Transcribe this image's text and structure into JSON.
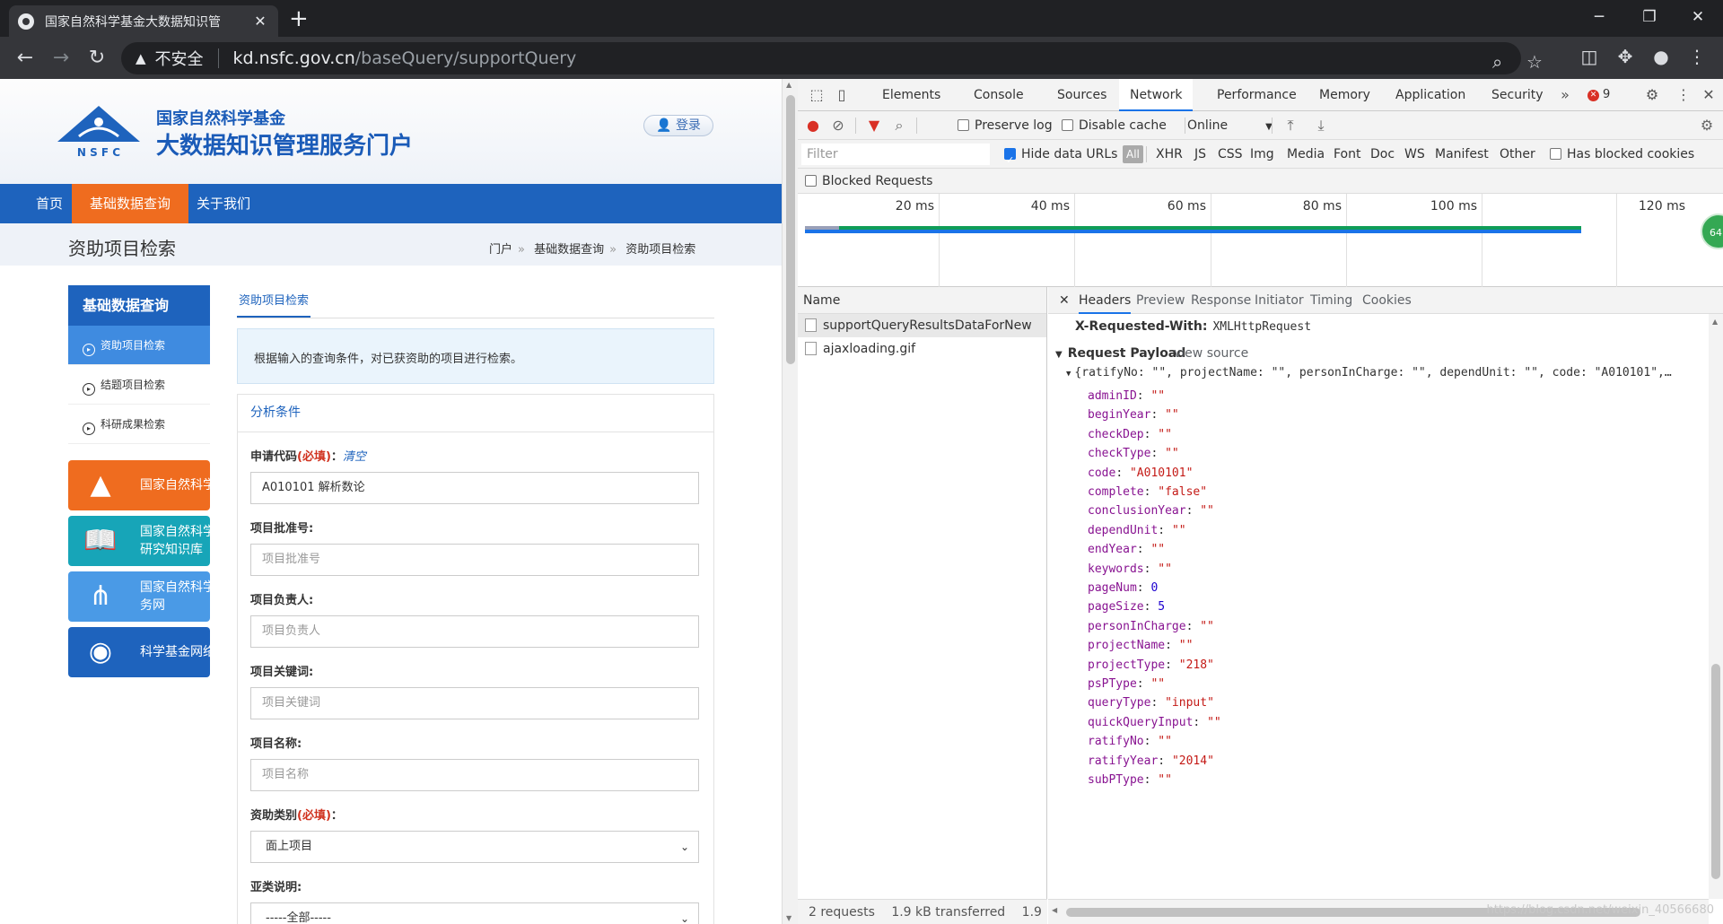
{
  "browser": {
    "tab_title": "国家自然科学基金大数据知识管",
    "url_insecure": "不安全",
    "url_host": "kd.nsfc.gov.cn",
    "url_path": "/baseQuery/supportQuery"
  },
  "site": {
    "logo_abbr": "N S F C",
    "logo_line1": "国家自然科学基金",
    "logo_line2": "大数据知识管理服务门户",
    "login": "登录",
    "nav": [
      "首页",
      "基础数据查询",
      "关于我们"
    ],
    "page_title": "资助项目检索",
    "breadcrumb": [
      "门户",
      "基础数据查询",
      "资助项目检索"
    ],
    "sidebar": {
      "head": "基础数据查询",
      "items": [
        "资助项目检索",
        "结题项目检索",
        "科研成果检索"
      ],
      "cards": [
        "国家自然科学",
        "国家自然科学",
        "研究知识库",
        "国家自然科学",
        "务网",
        "科学基金网络"
      ]
    },
    "content_tab": "资助项目检索",
    "info": "根据输入的查询条件，对已获资助的项目进行检索。",
    "form_head": "分析条件",
    "fields": {
      "code_label": "申请代码",
      "required": "(必填)",
      "colon": "：",
      "clear": "清空",
      "code_value": "A010101 解析数论",
      "ratify_label": "项目批准号:",
      "ratify_ph": "项目批准号",
      "person_label": "项目负责人:",
      "person_ph": "项目负责人",
      "keyword_label": "项目关键词:",
      "keyword_ph": "项目关键词",
      "name_label": "项目名称:",
      "name_ph": "项目名称",
      "type_label": "资助类别",
      "type_value": "面上项目",
      "subtype_label": "亚类说明:",
      "subtype_value": "-----全部-----"
    }
  },
  "devtools": {
    "tabs": [
      "Elements",
      "Console",
      "Sources",
      "Network",
      "Performance",
      "Memory",
      "Application",
      "Security"
    ],
    "error_count": "9",
    "toolbar": {
      "preserve_log": "Preserve log",
      "disable_cache": "Disable cache",
      "throttle": "Online"
    },
    "filter": {
      "placeholder": "Filter",
      "hide_data_urls": "Hide data URLs",
      "types": [
        "All",
        "XHR",
        "JS",
        "CSS",
        "Img",
        "Media",
        "Font",
        "Doc",
        "WS",
        "Manifest",
        "Other"
      ],
      "has_blocked": "Has blocked cookies",
      "blocked_requests": "Blocked Requests"
    },
    "overview_ticks": [
      "20 ms",
      "40 ms",
      "60 ms",
      "80 ms",
      "100 ms",
      "120 ms"
    ],
    "overview_badge": "64",
    "name_header": "Name",
    "requests": [
      "supportQueryResultsDataForNew",
      "ajaxloading.gif"
    ],
    "footer": [
      "2 requests",
      "1.9 kB transferred",
      "1.9"
    ],
    "detail_tabs": [
      "Headers",
      "Preview",
      "Response",
      "Initiator",
      "Timing",
      "Cookies"
    ],
    "header_key": "X-Requested-With:",
    "header_val": "XMLHttpRequest",
    "payload_title": "Request Payload",
    "view_source": "view source",
    "payload_summary": "{ratifyNo: \"\", projectName: \"\", personInCharge: \"\", dependUnit: \"\", code: \"A010101\",…",
    "props": [
      {
        "k": "adminID",
        "v": "\"\"",
        "t": "s"
      },
      {
        "k": "beginYear",
        "v": "\"\"",
        "t": "s"
      },
      {
        "k": "checkDep",
        "v": "\"\"",
        "t": "s"
      },
      {
        "k": "checkType",
        "v": "\"\"",
        "t": "s"
      },
      {
        "k": "code",
        "v": "\"A010101\"",
        "t": "s"
      },
      {
        "k": "complete",
        "v": "\"false\"",
        "t": "s"
      },
      {
        "k": "conclusionYear",
        "v": "\"\"",
        "t": "s"
      },
      {
        "k": "dependUnit",
        "v": "\"\"",
        "t": "s"
      },
      {
        "k": "endYear",
        "v": "\"\"",
        "t": "s"
      },
      {
        "k": "keywords",
        "v": "\"\"",
        "t": "s"
      },
      {
        "k": "pageNum",
        "v": "0",
        "t": "n"
      },
      {
        "k": "pageSize",
        "v": "5",
        "t": "n"
      },
      {
        "k": "personInCharge",
        "v": "\"\"",
        "t": "s"
      },
      {
        "k": "projectName",
        "v": "\"\"",
        "t": "s"
      },
      {
        "k": "projectType",
        "v": "\"218\"",
        "t": "s"
      },
      {
        "k": "psPType",
        "v": "\"\"",
        "t": "s"
      },
      {
        "k": "queryType",
        "v": "\"input\"",
        "t": "s"
      },
      {
        "k": "quickQueryInput",
        "v": "\"\"",
        "t": "s"
      },
      {
        "k": "ratifyNo",
        "v": "\"\"",
        "t": "s"
      },
      {
        "k": "ratifyYear",
        "v": "\"2014\"",
        "t": "s"
      },
      {
        "k": "subPType",
        "v": "\"\"",
        "t": "s"
      }
    ],
    "watermark": "https://blog.csdn.net/weixin_40566680"
  },
  "colors": {
    "brand_blue": "#1e63bd",
    "nav_active": "#ef6c1f",
    "devtools_accent": "#1a73e8"
  }
}
